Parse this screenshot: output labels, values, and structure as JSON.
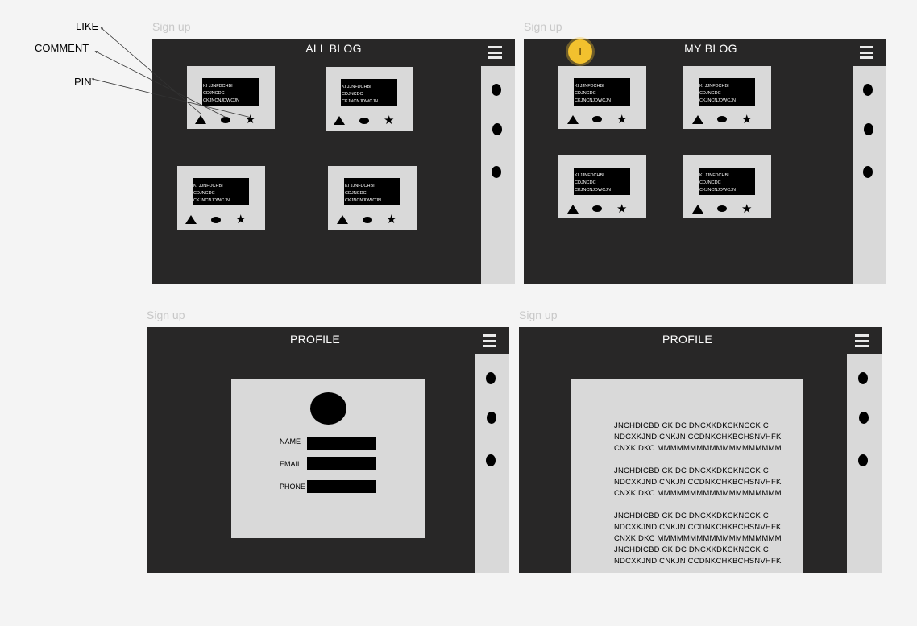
{
  "annotations": {
    "like": "LIKE",
    "comment": "COMMENT",
    "pin": "PIN"
  },
  "badge_text": "I",
  "card_text": [
    "KI JJNFDCHBI",
    "CDJNCDC",
    "CKJNCNJDWCJN"
  ],
  "frames": {
    "all_blog": {
      "label": "Sign up",
      "title": "ALL BLOG"
    },
    "my_blog": {
      "label": "Sign up",
      "title": "MY BLOG"
    },
    "profile_form": {
      "label": "Sign up",
      "title": "PROFILE"
    },
    "profile_text": {
      "label": "Sign up",
      "title": "PROFILE"
    }
  },
  "profile_form": {
    "fields": [
      "NAME",
      "EMAIL",
      "PHONE"
    ]
  },
  "profile_text": {
    "lines": [
      "JNCHDICBD CK DC DNCXKDKCKNCCK C",
      "NDCXKJND CNKJN CCDNKCHKBCHSNVHFK",
      "CNXK DKC MMMMMMMMMMMMMMMMMMM",
      "JNCHDICBD CK DC DNCXKDKCKNCCK C",
      "NDCXKJND CNKJN CCDNKCHKBCHSNVHFK",
      "CNXK DKC MMMMMMMMMMMMMMMMMMM",
      "JNCHDICBD CK DC DNCXKDKCKNCCK C",
      "NDCXKJND CNKJN CCDNKCHKBCHSNVHFK",
      "CNXK DKC MMMMMMMMMMMMMMMMMMM",
      "JNCHDICBD CK DC DNCXKDKCKNCCK C",
      "NDCXKJND CNKJN CCDNKCHKBCHSNVHFK"
    ]
  },
  "colors": {
    "frame_bg": "#282727",
    "panel_bg": "#d9d9d9",
    "page_bg": "#f4f4f4",
    "badge": "#f2c12e"
  },
  "icons": [
    "hamburger-menu-icon",
    "like-triangle-icon",
    "comment-ellipse-icon",
    "pin-star-icon",
    "sidebar-dot-icon"
  ]
}
